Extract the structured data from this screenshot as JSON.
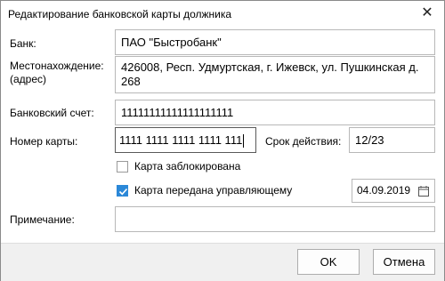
{
  "window": {
    "title": "Редактирование банковской карты должника",
    "close_label": "✕"
  },
  "form": {
    "bank_label": "Банк:",
    "bank_value": "ПАО \"Быстробанк\"",
    "location_label_line1": "Местонахождение:",
    "location_label_line2": "(адрес)",
    "location_value_line1": "426008,  Респ. Удмуртская,  г. Ижевск,  ул. Пушкинская д.",
    "location_value_line2": "268",
    "account_label": "Банковский счет:",
    "account_value": "11111111111111111111",
    "card_number_label": "Номер карты:",
    "card_number_value": "1111 1111 1111 1111 111",
    "expiry_label": "Срок действия:",
    "expiry_value": "12/23",
    "blocked_label": "Карта заблокирована",
    "blocked_checked": false,
    "transferred_label": "Карта передана управляющему",
    "transferred_checked": true,
    "transfer_date": "04.09.2019",
    "note_label": "Примечание:",
    "note_value": ""
  },
  "footer": {
    "ok_label": "OK",
    "cancel_label": "Отмена"
  },
  "colors": {
    "checkbox_accent": "#2b88d8",
    "footer_background": "#f0f0f0"
  }
}
